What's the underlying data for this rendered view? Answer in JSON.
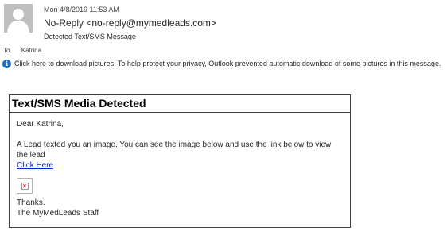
{
  "header": {
    "date": "Mon 4/8/2019 11:53 AM",
    "from": "No-Reply <no-reply@mymedleads.com>",
    "subject": "Detected Text/SMS Message",
    "to_label": "To",
    "to_value": "Katrina"
  },
  "infobar": {
    "icon": "info-icon",
    "text": "Click here to download pictures. To help protect your privacy, Outlook prevented automatic download of some pictures in this message."
  },
  "message": {
    "title": "Text/SMS Media Detected",
    "greeting": "Dear Katrina,",
    "body": "A Lead texted you an image. You can see the image below and use the link below to view the lead",
    "link_label": "Click Here",
    "broken_image_icon": "broken-image-icon",
    "signoff_1": "Thanks.",
    "signoff_2": "The MyMedLeads Staff"
  },
  "colors": {
    "link": "#0a2bd0",
    "info_icon": "#1e6fc4",
    "avatar_bg": "#bfbfbf"
  }
}
